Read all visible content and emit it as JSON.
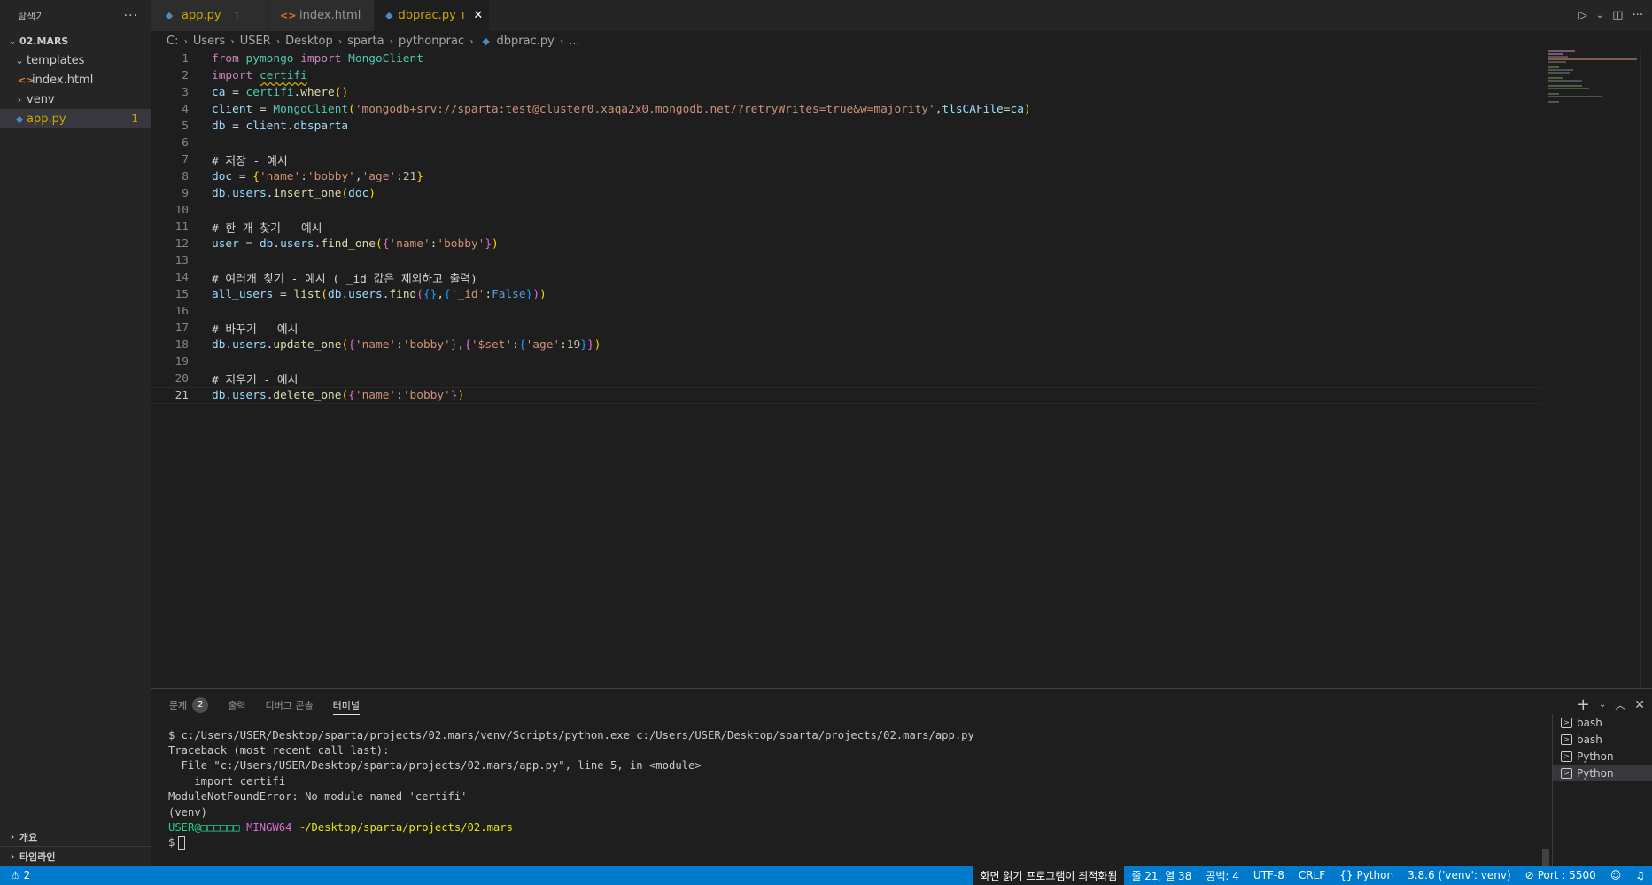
{
  "sidebar": {
    "title": "탐색기",
    "more": "···",
    "section": "02.MARS",
    "tree": [
      {
        "label": "templates",
        "type": "folder-open"
      },
      {
        "label": "index.html",
        "type": "html"
      },
      {
        "label": "venv",
        "type": "folder"
      },
      {
        "label": "app.py",
        "type": "py",
        "badge": "1"
      }
    ],
    "outline": "개요",
    "timeline": "타임라인"
  },
  "tabs": [
    {
      "name": "app.py",
      "count": "1"
    },
    {
      "name": "index.html"
    },
    {
      "name": "dbprac.py",
      "count": "1",
      "close": "✕"
    }
  ],
  "breadcrumb": [
    "C:",
    "Users",
    "USER",
    "Desktop",
    "sparta",
    "pythonprac",
    "dbprac.py",
    "..."
  ],
  "editor": {
    "line_numbers": [
      "1",
      "2",
      "3",
      "4",
      "5",
      "6",
      "7",
      "8",
      "9",
      "10",
      "11",
      "12",
      "13",
      "14",
      "15",
      "16",
      "17",
      "18",
      "19",
      "20",
      "21"
    ]
  },
  "panel": {
    "tabs": [
      {
        "label": "문제",
        "badge": "2"
      },
      {
        "label": "출력"
      },
      {
        "label": "디버그 콘솔"
      },
      {
        "label": "터미널"
      }
    ],
    "terminal": {
      "l1": "$ c:/Users/USER/Desktop/sparta/projects/02.mars/venv/Scripts/python.exe c:/Users/USER/Desktop/sparta/projects/02.mars/app.py",
      "l2": "Traceback (most recent call last):",
      "l3": "  File \"c:/Users/USER/Desktop/sparta/projects/02.mars/app.py\", line 5, in <module>",
      "l4": "    import certifi",
      "l5": "ModuleNotFoundError: No module named 'certifi'",
      "l6": "(venv)",
      "prompt_user": "USER@□□□□□□",
      "prompt_sys": "MINGW64",
      "prompt_path": "~/Desktop/sparta/projects/02.mars",
      "prompt": "$"
    },
    "terminals": [
      "bash",
      "bash",
      "Python",
      "Python"
    ]
  },
  "status": {
    "warnings": "⚠ 2",
    "reader": "화면 읽기 프로그램이 최적화됨",
    "position": "줄 21, 열 38",
    "spaces": "공백: 4",
    "encoding": "UTF-8",
    "eol": "CRLF",
    "language": "Python",
    "interpreter": "3.8.6 ('venv': venv)",
    "port": "Port : 5500"
  }
}
